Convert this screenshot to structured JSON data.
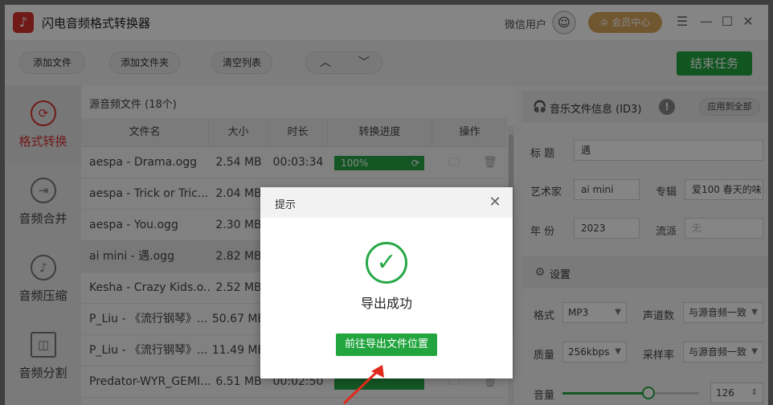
{
  "app": {
    "title": "闪电音频格式转换器",
    "user_label": "微信用户",
    "vip_label": "会员中心"
  },
  "toolbar": {
    "add_file": "添加文件",
    "add_folder": "添加文件夹",
    "clear_list": "清空列表",
    "end_task": "结束任务"
  },
  "sidebar": {
    "items": [
      {
        "label": "格式转换",
        "active": true
      },
      {
        "label": "音频合并"
      },
      {
        "label": "音频压缩"
      },
      {
        "label": "音频分割"
      }
    ]
  },
  "file_panel": {
    "header": "源音频文件 (18个)",
    "columns": [
      "文件名",
      "大小",
      "时长",
      "转换进度",
      "操作"
    ],
    "rows": [
      {
        "name": "aespa - Drama.ogg",
        "size": "2.54 MB",
        "duration": "00:03:34",
        "progress": "100%"
      },
      {
        "name": "aespa - Trick or Tric...",
        "size": "2.04 MB",
        "duration": "",
        "progress": ""
      },
      {
        "name": "aespa - You.ogg",
        "size": "2.30 MB",
        "duration": "",
        "progress": ""
      },
      {
        "name": "ai mini - 遇.ogg",
        "size": "2.82 MB",
        "duration": "",
        "progress": ""
      },
      {
        "name": "Kesha - Crazy Kids.o...",
        "size": "2.52 MB",
        "duration": "",
        "progress": ""
      },
      {
        "name": "P_Liu - 《流行钢琴》...",
        "size": "50.67 MB",
        "duration": "",
        "progress": ""
      },
      {
        "name": "P_Liu - 《流行钢琴》...",
        "size": "11.49 MB",
        "duration": "",
        "progress": ""
      },
      {
        "name": "Predator-WYR_GEMI...",
        "size": "6.51 MB",
        "duration": "00:02:50",
        "progress": ""
      }
    ]
  },
  "id3": {
    "header": "音乐文件信息 (ID3)",
    "apply_all": "应用到全部",
    "title_label": "标  题",
    "title_value": "遇",
    "artist_label": "艺术家",
    "artist_value": "ai mini",
    "album_label": "专辑",
    "album_value": "爱100 春天的味",
    "year_label": "年  份",
    "year_value": "2023",
    "genre_label": "流派",
    "genre_placeholder": "无"
  },
  "settings": {
    "header": "设置",
    "format_label": "格式",
    "format_value": "MP3",
    "channels_label": "声道数",
    "channels_value": "与源音频一致",
    "quality_label": "质量",
    "quality_value": "256kbps",
    "samplerate_label": "采样率",
    "samplerate_value": "与源音频一致",
    "volume_label": "音量",
    "volume_value": "126",
    "volume_level_fraction": 0.63
  },
  "dialog": {
    "title": "提示",
    "message": "导出成功",
    "button": "前往导出文件位置"
  },
  "colors": {
    "accent_green": "#22a53f",
    "brand_red": "#d7332f",
    "vip_gold": "#d8a85c"
  }
}
